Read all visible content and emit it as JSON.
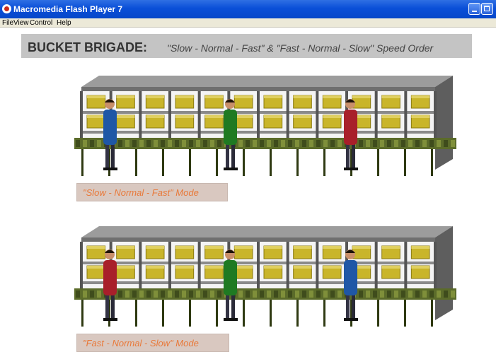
{
  "window": {
    "title": "Macromedia Flash Player 7",
    "icon": "flash-player-icon",
    "minimize_icon": "minimize-icon",
    "maximize_icon": "maximize-icon"
  },
  "menu": {
    "items": [
      {
        "label": "File"
      },
      {
        "label": "View"
      },
      {
        "label": "Control"
      },
      {
        "label": "Help"
      }
    ]
  },
  "banner": {
    "title": "BUCKET BRIGADE:",
    "subtitle": "\"Slow - Normal - Fast\"  &  \"Fast - Normal - Slow\" Speed Order"
  },
  "scenes": [
    {
      "label": "\"Slow - Normal - Fast\" Mode",
      "workers": [
        {
          "role": "slow",
          "color": "#1f57a6"
        },
        {
          "role": "normal",
          "color": "#1f7a22"
        },
        {
          "role": "fast",
          "color": "#a81f2a"
        }
      ]
    },
    {
      "label": "\"Fast - Normal - Slow\" Mode",
      "workers": [
        {
          "role": "fast",
          "color": "#a81f2a"
        },
        {
          "role": "normal",
          "color": "#1f7a22"
        },
        {
          "role": "slow",
          "color": "#1f57a6"
        }
      ]
    }
  ],
  "colors": {
    "titlebar": "#0a4fd8",
    "banner_bg": "#c4c4c4",
    "label_text": "#e8793a",
    "label_bg": "#d9c8c0",
    "box": "#c9b52a",
    "conveyor": "#5b6b2a",
    "shelf": "#8a8a8a"
  }
}
